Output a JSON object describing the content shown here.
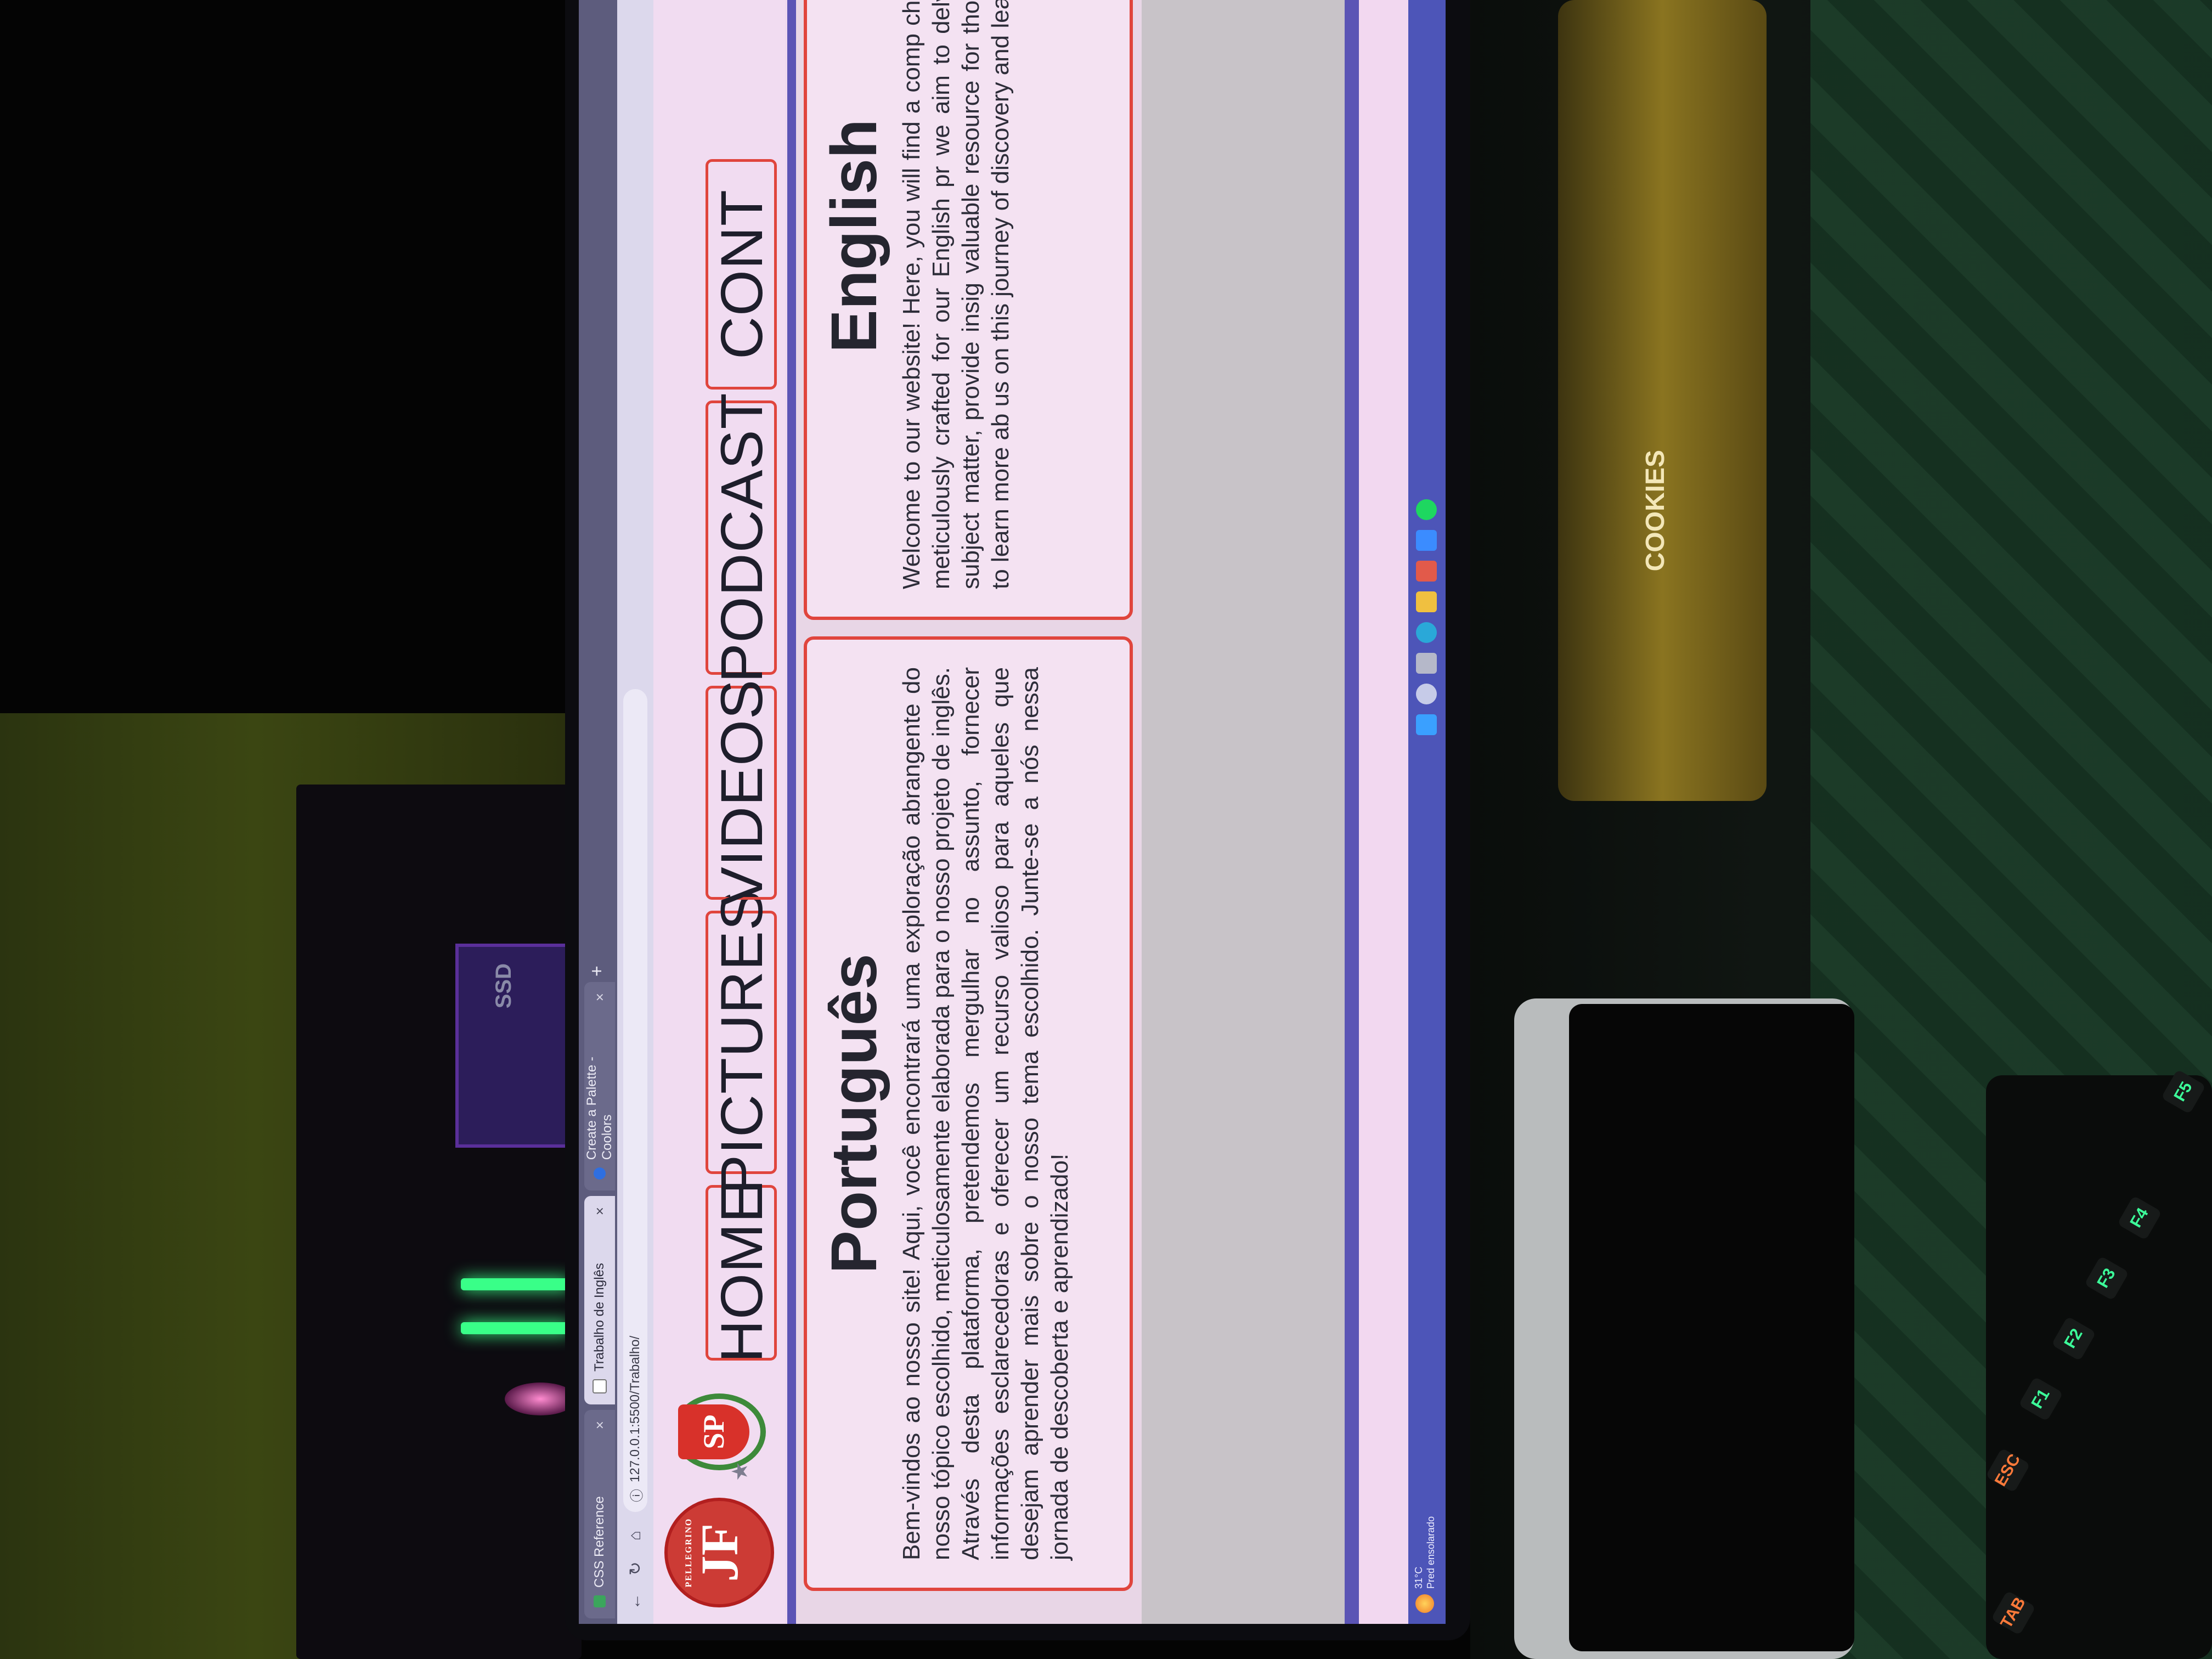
{
  "browser": {
    "tabs": [
      {
        "label": "CSS Reference"
      },
      {
        "label": "Trabalho de Inglês"
      },
      {
        "label": "Create a Palette - Coolors"
      }
    ],
    "address": "127.0.0.1:5500/Trabalho/"
  },
  "site": {
    "logo_jf_text": "JF",
    "logo_jf_caption": "PELLEGRINO",
    "logo_sp_text": "SP",
    "nav": [
      "HOME",
      "PICTURES",
      "VIDEOS",
      "PODCAST",
      "CONT"
    ],
    "cards": {
      "pt": {
        "title": "Português",
        "body": "Bem-vindos ao nosso site! Aqui, você encontrará uma exploração abrangente do nosso tópico escolhido, meticulosamente elaborada para o nosso projeto de inglês. Através desta plataforma, pretendemos mergulhar no assunto, fornecer informações esclarecedoras e oferecer um recurso valioso para aqueles que desejam aprender mais sobre o nosso tema escolhido. Junte-se a nós nessa jornada de descoberta e aprendizado!"
      },
      "en": {
        "title": "English",
        "body": "Welcome to our website! Here, you will find a comp chosen topic, meticulously crafted for our English pr we aim to delve into the subject matter, provide insig valuable resource for those seeking to learn more ab us on this journey of discovery and learning!"
      }
    }
  },
  "taskbar": {
    "weather_temp": "31°C",
    "weather_desc": "Pred ensolarado"
  },
  "scene": {
    "ssd_label": "SSD",
    "snack_label": "COOKIES",
    "keys": [
      "ESC",
      "F1",
      "F2",
      "F3",
      "F4",
      "F5",
      "TAB"
    ]
  },
  "colors": {
    "accent_border": "#e0453d",
    "divider": "#5b54b5",
    "page_bg": "#efd9ef"
  }
}
